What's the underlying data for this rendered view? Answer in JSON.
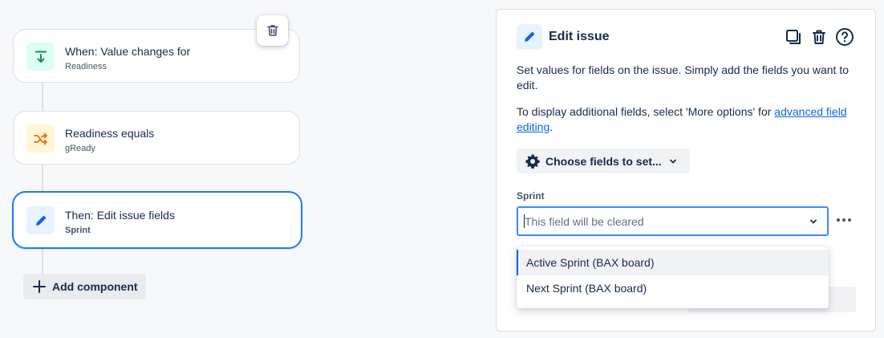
{
  "flow": {
    "trigger": {
      "title": "When: Value changes for",
      "subtitle": "Readiness",
      "icon": "download-arrow-icon",
      "icon_bg": "#dcfff1",
      "icon_color": "#1f845a"
    },
    "condition": {
      "title": "Readiness equals",
      "subtitle": "gReady",
      "icon": "shuffle-icon",
      "icon_bg": "#fff7d6",
      "icon_color": "#e56910"
    },
    "action": {
      "title": "Then: Edit issue fields",
      "subtitle": "Sprint",
      "icon": "pencil-icon",
      "icon_bg": "#e9f2ff",
      "icon_color": "#0c66e4"
    },
    "add_component_label": "Add component"
  },
  "panel": {
    "title": "Edit issue",
    "description": "Set values for fields on the issue. Simply add the fields you want to edit.",
    "additional_text": "To display additional fields, select 'More options' for",
    "additional_link": "advanced field editing",
    "additional_suffix": ".",
    "choose_fields_label": "Choose fields to set...",
    "field": {
      "label": "Sprint",
      "placeholder": "This field will be cleared",
      "options": [
        "Active Sprint (BAX board)",
        "Next Sprint (BAX board)"
      ],
      "highlighted_option": "Active Sprint (BAX board)"
    }
  },
  "colors": {
    "accent": "#1d7afc",
    "link": "#0c66e4",
    "text": "#172b4d"
  }
}
